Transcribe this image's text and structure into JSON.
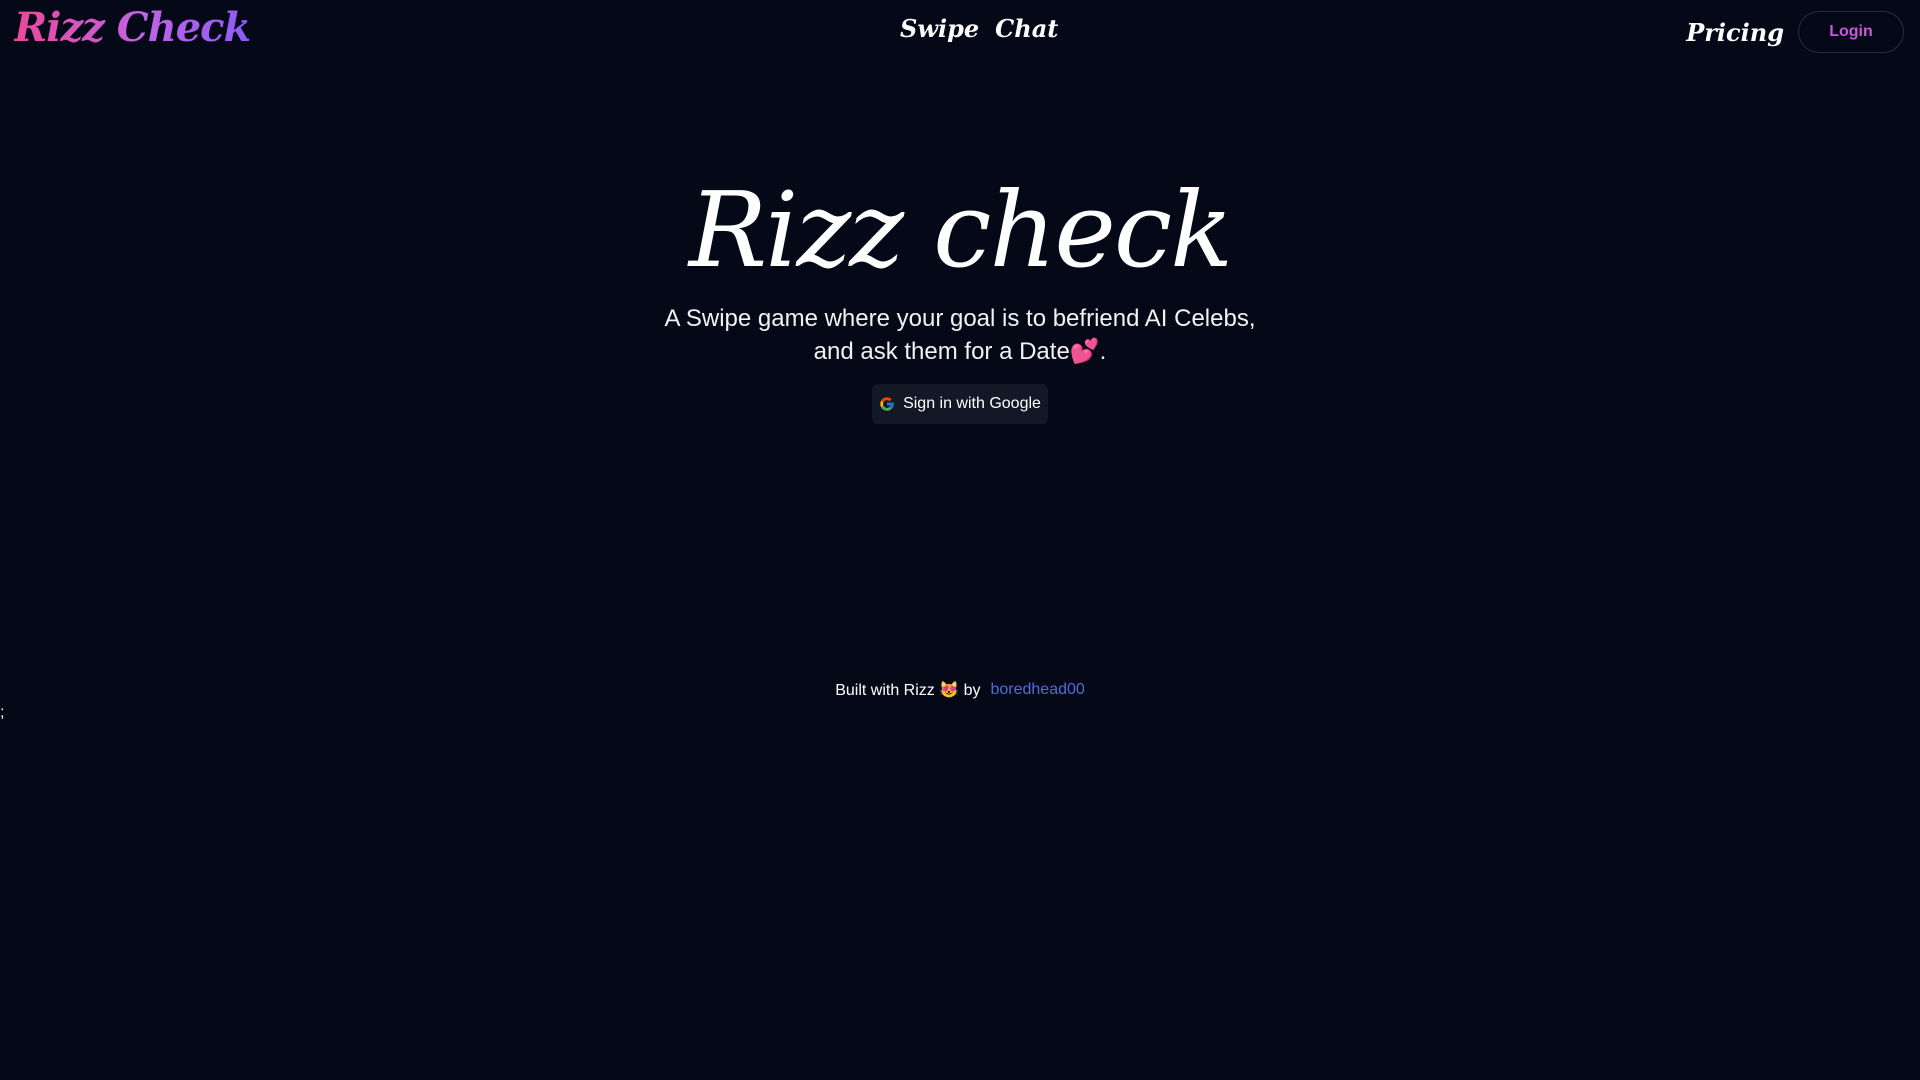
{
  "header": {
    "logo": "Rizz Check",
    "nav": [
      {
        "label": "Swipe"
      },
      {
        "label": "Chat"
      }
    ],
    "pricing_label": "Pricing",
    "login_label": "Login"
  },
  "hero": {
    "title": "Rizz check",
    "subtitle_line1": "A Swipe game where your goal is to befriend AI Celebs,",
    "subtitle_line2": "and ask them for a Date💕."
  },
  "signin": {
    "label": "Sign in with Google",
    "icon": "google-icon"
  },
  "footer": {
    "text_prefix": "Built with Rizz 😻 by",
    "author": "boredhead00"
  },
  "stray_text": ";",
  "colors": {
    "background": "#050816",
    "logo_gradient_start": "#ec4899",
    "logo_gradient_end": "#8b5cf6",
    "login_text": "#c65ad6",
    "footer_link": "#4f6fd6",
    "button_bg": "#131827"
  }
}
